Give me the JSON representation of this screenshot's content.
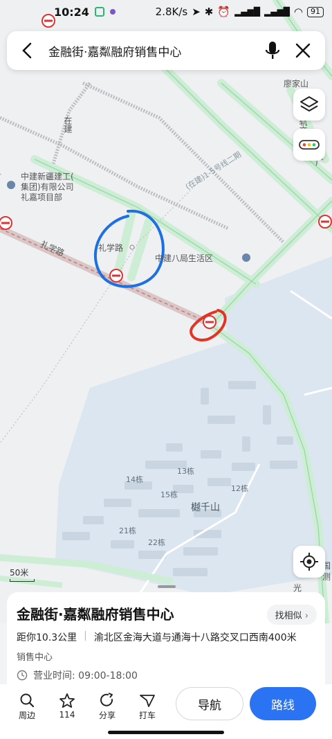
{
  "status_bar": {
    "time": "10:24",
    "network_speed": "2.8K/s",
    "battery": "91"
  },
  "search": {
    "query": "金融街·嘉粼融府销售中心"
  },
  "map": {
    "labels": {
      "liaojiashan": "廖家山",
      "zaijian": "在建",
      "company_line1": "中建新疆建工(",
      "company_line2": "集团)有限公司",
      "company_line3": "礼嘉项目部",
      "lixuelu_poi": "礼学路",
      "lixuelu_road": "礼学路",
      "zhongjian_ba": "中建八局生活区",
      "metro_line": "(在建)1-5号线二期",
      "jiao": "轨交",
      "guang": "广",
      "shan": "樾千山",
      "b14": "14栋",
      "b13": "13栋",
      "b15": "15栋",
      "b12": "12栋",
      "b21": "21栋",
      "b22": "22栋",
      "guo": "国",
      "ce": "测",
      "guang2": "光"
    },
    "scale_label": "50米"
  },
  "place": {
    "name": "金融街·嘉粼融府销售中心",
    "similar_button": "找相似",
    "distance": "距你10.3公里",
    "address": "渝北区金海大道与通海十八路交叉口西南400米",
    "category": "销售中心",
    "hours": "营业时间: 09:00-18:00"
  },
  "actions": {
    "nearby": "周边",
    "favorite_count": "114",
    "share": "分享",
    "taxi": "打车",
    "navigate": "导航",
    "route": "路线"
  },
  "colors": {
    "primary": "#2a73f3",
    "road_green": "#bfe8c9",
    "water": "#dde8f2"
  }
}
